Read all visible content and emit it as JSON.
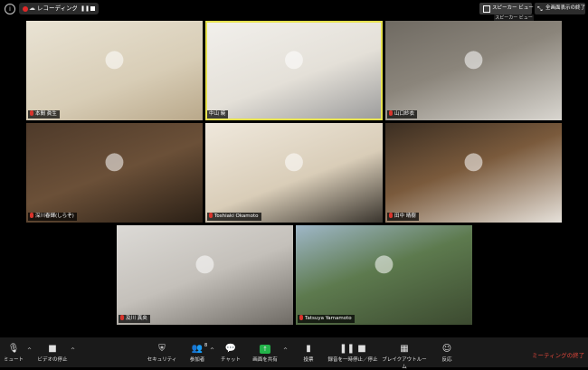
{
  "top_bar": {
    "recording_label": "レコーディング...",
    "speaker_view_label": "スピーカー ビュー",
    "speaker_view_tooltip": "スピーカー ビュー",
    "fullscreen_exit_label": "全画面表示の終了"
  },
  "participants": [
    {
      "name": "本間 眞生",
      "muted": true,
      "active": false
    },
    {
      "name": "中山 暁",
      "muted": false,
      "active": true
    },
    {
      "name": "山口紗衣",
      "muted": true,
      "active": false
    },
    {
      "name": "深川春輝(しらぞ)",
      "muted": true,
      "active": false
    },
    {
      "name": "Toshiaki Okamoto",
      "muted": true,
      "active": false
    },
    {
      "name": "田中 晴樹",
      "muted": true,
      "active": false
    },
    {
      "name": "及川 真央",
      "muted": true,
      "active": false
    },
    {
      "name": "Tatsuya Yamamoto",
      "muted": true,
      "active": false
    }
  ],
  "toolbar": {
    "mute": "ミュート",
    "video_stop": "ビデオの停止",
    "security": "セキュリティ",
    "participants": "参加者",
    "participants_count": "8",
    "chat": "チャット",
    "share_screen": "画面を共有",
    "polls": "投票",
    "pause_recording": "録音を一時停止／停止",
    "breakout_rooms": "ブレイクアウトルーム",
    "reactions": "反応",
    "end_meeting": "ミーティングの終了"
  },
  "colors": {
    "active_speaker_border": "#e7e24f",
    "share_green": "#23b34a",
    "end_red": "#e0463b",
    "record_red": "#e02828"
  }
}
